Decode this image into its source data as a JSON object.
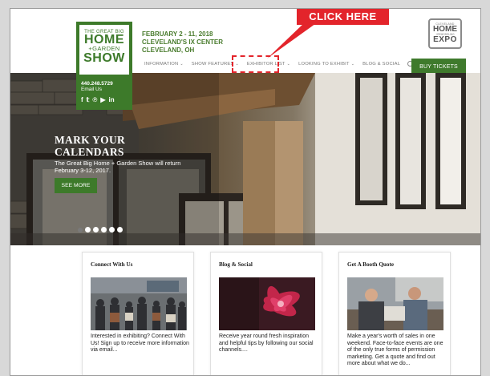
{
  "header": {
    "event_dates": "FEBRUARY 2 - 11, 2018",
    "event_venue": "CLEVELAND'S IX CENTER",
    "event_city": "CLEVELAND, OH",
    "buy_tickets": "BUY TICKETS"
  },
  "logo": {
    "line1": "THE GREAT BIG",
    "line2": "HOME",
    "line3": "+GARDEN",
    "line4": "SHOW",
    "phone": "440.248.5729",
    "email": "Email Us"
  },
  "social_icons": [
    "facebook-icon",
    "twitter-icon",
    "pinterest-icon",
    "youtube-icon",
    "linkedin-icon"
  ],
  "social_glyphs": [
    "f",
    "𝕥",
    "℗",
    "▶",
    "in"
  ],
  "expo_logo": {
    "l1": "CLEVELAND",
    "l2": "HOME",
    "l3": "+REMODELING",
    "l4": "EXPO"
  },
  "nav": {
    "items": [
      {
        "label": "INFORMATION",
        "has_caret": true
      },
      {
        "label": "SHOW FEATURES",
        "has_caret": true
      },
      {
        "label": "EXHIBITOR LIST",
        "has_caret": true
      },
      {
        "label": "LOOKING TO EXHIBIT",
        "has_caret": true
      },
      {
        "label": "BLOG & SOCIAL",
        "has_caret": false
      }
    ],
    "caret": "⌄"
  },
  "callout": {
    "label": "CLICK HERE",
    "color": "#e3242b"
  },
  "hero": {
    "title_line1": "MARK YOUR",
    "title_line2": "CALENDARS",
    "subtitle": "The Great Big Home + Garden Show will return February 3-12, 2017.",
    "cta": "SEE MORE",
    "slide_count": 6,
    "active_slide": 0
  },
  "cards": [
    {
      "title": "Connect With Us",
      "text": "Interested in exhibiting? Connect With Us! Sign up to receive more information via email..."
    },
    {
      "title": "Blog & Social",
      "text": "Receive year round fresh inspiration and helpful tips by following our social channels...."
    },
    {
      "title": "Get A Booth Quote",
      "text": "Make a year's worth of sales in one weekend. Face-to-face events are one of the only true forms of permission marketing. Get a quote and find out more about what we do..."
    }
  ],
  "colors": {
    "brand_green": "#3d7a2a",
    "accent_red": "#e3242b"
  }
}
